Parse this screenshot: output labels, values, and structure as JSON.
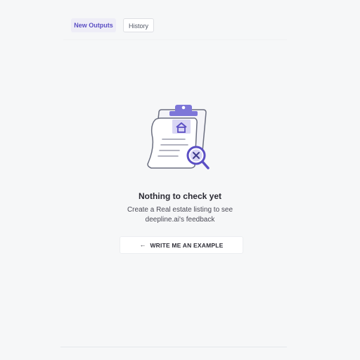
{
  "tabs": [
    {
      "label": "New Outputs",
      "active": true
    },
    {
      "label": "History",
      "active": false
    }
  ],
  "empty_state": {
    "title": "Nothing to check yet",
    "description_line1": "Create a Real estate listing to see",
    "description_line2": "deepline.ai's feedback",
    "illustration_icon": "clipboard-document-search-icon"
  },
  "example_button": {
    "icon": "arrow-left-icon",
    "arrow_glyph": "←",
    "label": "WRITE ME AN EXAMPLE"
  },
  "colors": {
    "accent": "#5b4fc4",
    "illustration_purple": "#7d76d8",
    "background": "#f6f7f8"
  }
}
